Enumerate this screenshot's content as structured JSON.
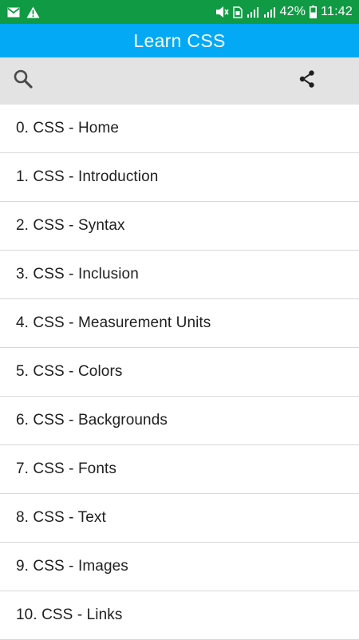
{
  "status_bar": {
    "left_icons": [
      "gmail-icon",
      "warning-icon"
    ],
    "right_icons": [
      "mute-icon",
      "sim-icon",
      "signal-icon",
      "signal-icon",
      "battery-icon"
    ],
    "battery": "42%",
    "time": "11:42",
    "background": "#119a44"
  },
  "app_bar": {
    "title": "Learn CSS",
    "background": "#03a9f4"
  },
  "toolbar": {
    "search_icon": "search-icon",
    "share_icon": "share-icon",
    "background": "#e3e3e3"
  },
  "topics": [
    {
      "label": "0. CSS - Home"
    },
    {
      "label": "1. CSS - Introduction"
    },
    {
      "label": "2. CSS - Syntax"
    },
    {
      "label": "3. CSS - Inclusion"
    },
    {
      "label": "4. CSS - Measurement Units"
    },
    {
      "label": "5. CSS - Colors"
    },
    {
      "label": "6. CSS - Backgrounds"
    },
    {
      "label": "7. CSS - Fonts"
    },
    {
      "label": "8. CSS - Text"
    },
    {
      "label": "9. CSS - Images"
    },
    {
      "label": "10. CSS - Links"
    }
  ]
}
